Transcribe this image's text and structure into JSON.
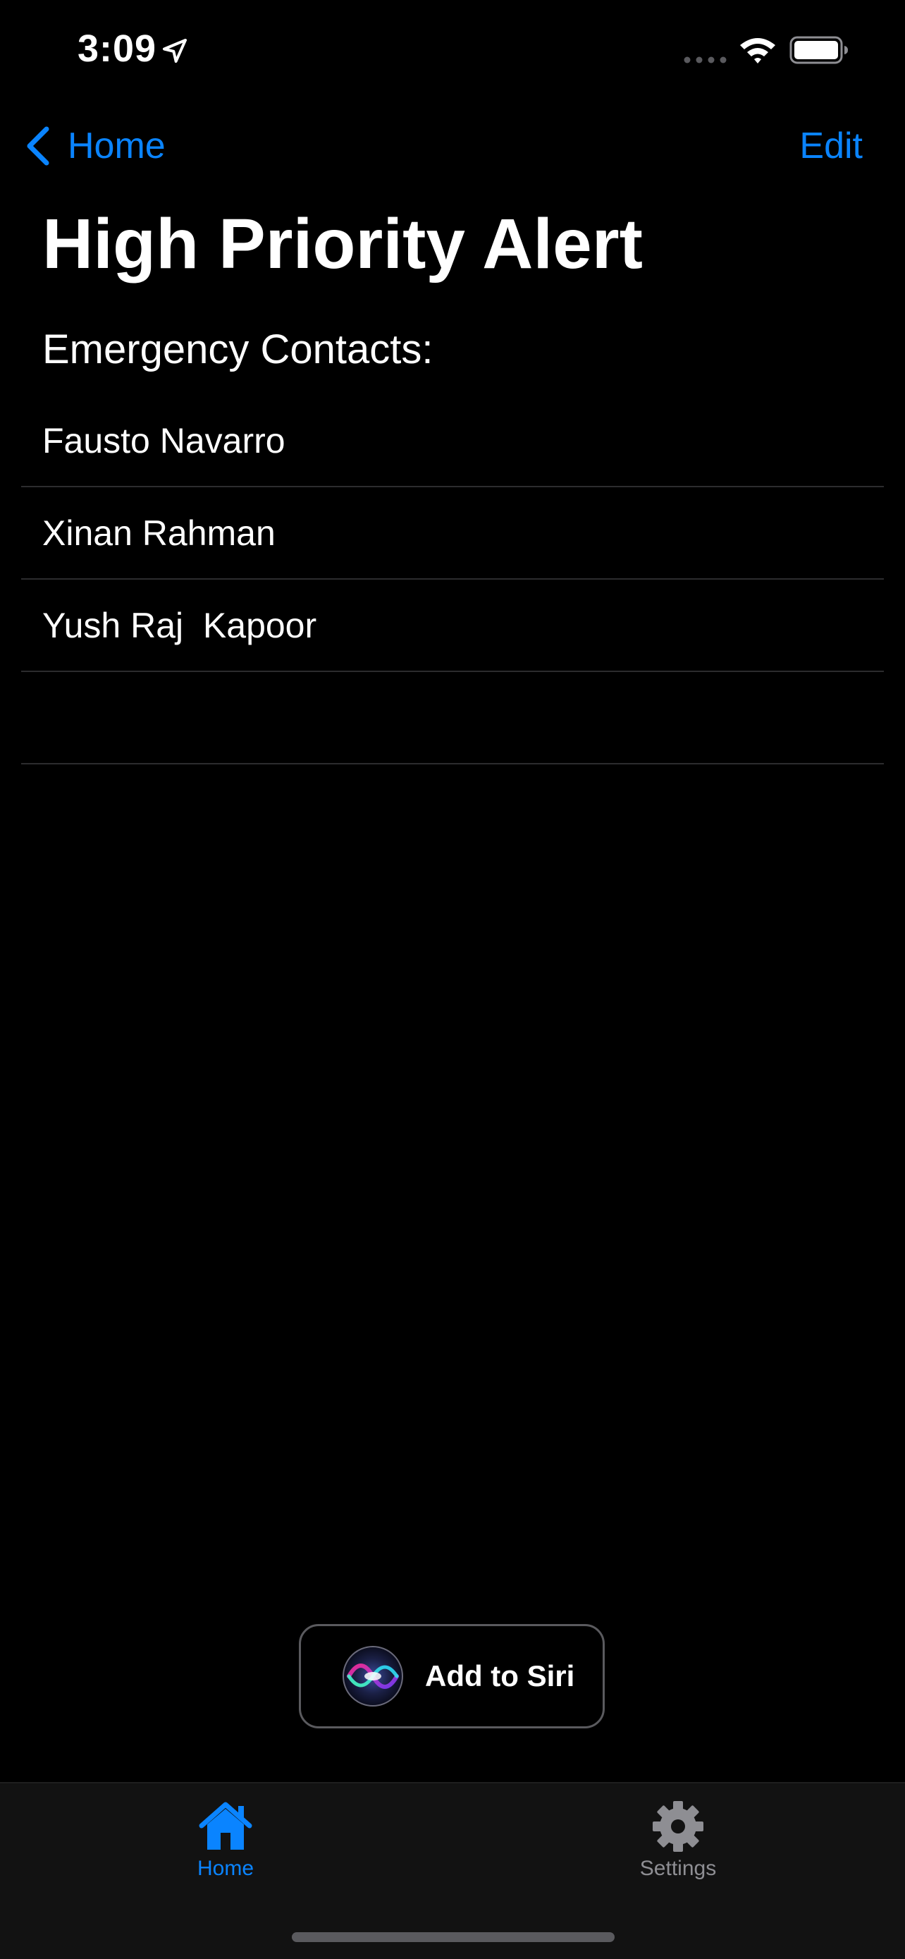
{
  "status_bar": {
    "time": "3:09",
    "icons": [
      "location-arrow-icon",
      "signal-icon",
      "wifi-icon",
      "battery-icon"
    ]
  },
  "nav": {
    "back_label": "Home",
    "edit_label": "Edit"
  },
  "title": "High Priority Alert",
  "section_label": "Emergency Contacts:",
  "contacts": [
    "Fausto Navarro",
    "Xinan Rahman",
    "Yush Raj  Kapoor",
    ""
  ],
  "siri_button": {
    "label": "Add to Siri",
    "icon": "siri-icon"
  },
  "tab_bar": {
    "items": [
      {
        "label": "Home",
        "icon": "house-icon",
        "selected": true
      },
      {
        "label": "Settings",
        "icon": "gear-icon",
        "selected": false
      }
    ]
  },
  "colors": {
    "accent": "#0a84ff",
    "background": "#000000",
    "tab_bar_background": "#121212",
    "separator": "#2c2c2e",
    "inactive_tab": "#8e8e93"
  }
}
